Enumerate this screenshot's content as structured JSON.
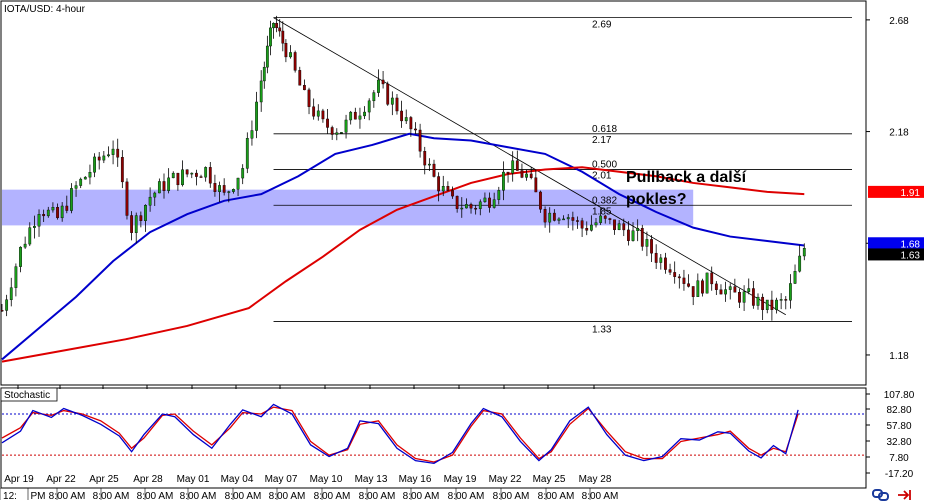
{
  "chart_data": [
    {
      "type": "candlestick",
      "title": "IOTA/USD: 4-hour",
      "ylim": [
        1.05,
        2.76
      ],
      "y_ticks": [
        2.68,
        2.18,
        1.68,
        1.18
      ],
      "x_ticks": [
        "Apr 19",
        "Apr 22",
        "Apr 25",
        "Apr 28",
        "May 01",
        "May 04",
        "May 07",
        "May 10",
        "May 13",
        "May 16",
        "May 19",
        "May 22",
        "May 25",
        "May 28"
      ],
      "x_time_ticks": [
        "12:",
        "PM",
        "8:00 AM",
        "8:00 AM",
        "8:00 AM",
        "8:00 AM",
        "8:00 AM",
        "8:00 AM",
        "8:00 AM",
        "8:00 AM",
        "8:00 AM",
        "8:00 AM",
        "8:00 AM",
        "8:00 AM",
        "8:00 AM"
      ],
      "price_path": [
        [
          0,
          1.38
        ],
        [
          3,
          1.65
        ],
        [
          6,
          1.84
        ],
        [
          9,
          1.79
        ],
        [
          12,
          1.93
        ],
        [
          15,
          2.03
        ],
        [
          18,
          2.12
        ],
        [
          21,
          1.75
        ],
        [
          24,
          1.89
        ],
        [
          27,
          1.96
        ],
        [
          30,
          1.99
        ],
        [
          33,
          2.01
        ],
        [
          36,
          1.89
        ],
        [
          39,
          2.02
        ],
        [
          42,
          2.41
        ],
        [
          44,
          2.67
        ],
        [
          46,
          2.55
        ],
        [
          49,
          2.33
        ],
        [
          52,
          2.21
        ],
        [
          55,
          2.19
        ],
        [
          58,
          2.28
        ],
        [
          61,
          2.38
        ],
        [
          64,
          2.29
        ],
        [
          67,
          2.15
        ],
        [
          70,
          1.97
        ],
        [
          73,
          1.86
        ],
        [
          76,
          1.84
        ],
        [
          79,
          1.88
        ],
        [
          82,
          2.02
        ],
        [
          85,
          1.98
        ],
        [
          88,
          1.81
        ],
        [
          91,
          1.82
        ],
        [
          94,
          1.75
        ],
        [
          97,
          1.78
        ],
        [
          100,
          1.75
        ],
        [
          103,
          1.71
        ],
        [
          106,
          1.62
        ],
        [
          109,
          1.57
        ],
        [
          112,
          1.47
        ],
        [
          115,
          1.52
        ],
        [
          118,
          1.45
        ],
        [
          121,
          1.44
        ],
        [
          124,
          1.39
        ],
        [
          127,
          1.42
        ],
        [
          130,
          1.66
        ]
      ],
      "series": [
        {
          "color": "#0000cc",
          "values": [
            [
              0,
              1.16
            ],
            [
              6,
              1.3
            ],
            [
              12,
              1.44
            ],
            [
              18,
              1.6
            ],
            [
              24,
              1.73
            ],
            [
              30,
              1.81
            ],
            [
              36,
              1.87
            ],
            [
              42,
              1.9
            ],
            [
              48,
              1.98
            ],
            [
              54,
              2.08
            ],
            [
              60,
              2.12
            ],
            [
              66,
              2.17
            ],
            [
              70,
              2.15
            ],
            [
              76,
              2.14
            ],
            [
              82,
              2.11
            ],
            [
              88,
              2.08
            ],
            [
              94,
              2.0
            ],
            [
              100,
              1.9
            ],
            [
              106,
              1.82
            ],
            [
              112,
              1.75
            ],
            [
              118,
              1.71
            ],
            [
              124,
              1.69
            ],
            [
              130,
              1.67
            ]
          ]
        },
        {
          "color": "#dd0000",
          "values": [
            [
              0,
              1.15
            ],
            [
              10,
              1.2
            ],
            [
              20,
              1.25
            ],
            [
              30,
              1.31
            ],
            [
              40,
              1.39
            ],
            [
              46,
              1.51
            ],
            [
              52,
              1.62
            ],
            [
              58,
              1.74
            ],
            [
              64,
              1.83
            ],
            [
              70,
              1.89
            ],
            [
              76,
              1.95
            ],
            [
              82,
              1.99
            ],
            [
              88,
              2.01
            ],
            [
              94,
              2.02
            ],
            [
              100,
              2.0
            ],
            [
              106,
              1.98
            ],
            [
              112,
              1.95
            ],
            [
              118,
              1.93
            ],
            [
              124,
              1.91
            ],
            [
              130,
              1.9
            ]
          ]
        }
      ],
      "fib_levels": [
        {
          "label": "2.69",
          "value": 2.69
        },
        {
          "label": "0.618",
          "value": 2.17,
          "price_label": "2.17"
        },
        {
          "label": "0.500",
          "value": 2.01,
          "price_label": "2.01"
        },
        {
          "label": "0.382",
          "value": 1.85,
          "price_label": "1.85"
        },
        {
          "label": "1.33",
          "value": 1.33
        }
      ],
      "zone": {
        "from": 1.76,
        "to": 1.92
      },
      "trendline": {
        "from": [
          44,
          2.69
        ],
        "to": [
          127,
          1.36
        ]
      },
      "annotation": "Pullback a další pokles?",
      "price_badges": [
        {
          "label": "1.91",
          "value": 1.91,
          "color": "#ff0000",
          "text_color": "#ffffff"
        },
        {
          "label": "1.68",
          "value": 1.68,
          "color": "#0000ee",
          "text_color": "#ffffff"
        },
        {
          "label": "1.63",
          "value": 1.63,
          "color": "#000000",
          "text_color": "#ffffff"
        }
      ],
      "x_range": [
        0,
        140
      ]
    },
    {
      "type": "line",
      "title": "Stochastic",
      "ylim": [
        -25,
        115
      ],
      "y_ticks": [
        "107.80",
        "82.80",
        "57.80",
        "32.80",
        "7.80",
        "-17.20"
      ],
      "levels": [
        80,
        20
      ],
      "series": [
        {
          "color": "#dd0000",
          "values": [
            [
              0,
              45
            ],
            [
              3,
              60
            ],
            [
              5,
              82
            ],
            [
              8,
              78
            ],
            [
              10,
              85
            ],
            [
              13,
              80
            ],
            [
              16,
              70
            ],
            [
              19,
              52
            ],
            [
              21,
              30
            ],
            [
              23,
              45
            ],
            [
              26,
              78
            ],
            [
              28,
              80
            ],
            [
              31,
              55
            ],
            [
              34,
              35
            ],
            [
              37,
              60
            ],
            [
              39,
              82
            ],
            [
              42,
              80
            ],
            [
              44,
              90
            ],
            [
              47,
              85
            ],
            [
              50,
              40
            ],
            [
              53,
              20
            ],
            [
              56,
              28
            ],
            [
              58,
              65
            ],
            [
              61,
              70
            ],
            [
              64,
              35
            ],
            [
              67,
              15
            ],
            [
              70,
              10
            ],
            [
              73,
              20
            ],
            [
              76,
              62
            ],
            [
              78,
              85
            ],
            [
              81,
              80
            ],
            [
              84,
              45
            ],
            [
              87,
              15
            ],
            [
              89,
              25
            ],
            [
              92,
              65
            ],
            [
              95,
              88
            ],
            [
              98,
              55
            ],
            [
              101,
              25
            ],
            [
              104,
              15
            ],
            [
              107,
              15
            ],
            [
              110,
              40
            ],
            [
              113,
              45
            ],
            [
              116,
              50
            ],
            [
              118,
              55
            ],
            [
              121,
              30
            ],
            [
              123,
              20
            ],
            [
              125,
              30
            ],
            [
              127,
              25
            ],
            [
              129,
              80
            ]
          ]
        },
        {
          "color": "#0000cc",
          "values": [
            [
              0,
              38
            ],
            [
              3,
              55
            ],
            [
              5,
              85
            ],
            [
              8,
              75
            ],
            [
              10,
              88
            ],
            [
              13,
              78
            ],
            [
              16,
              65
            ],
            [
              19,
              48
            ],
            [
              21,
              25
            ],
            [
              23,
              50
            ],
            [
              26,
              80
            ],
            [
              28,
              76
            ],
            [
              31,
              50
            ],
            [
              34,
              30
            ],
            [
              37,
              65
            ],
            [
              39,
              86
            ],
            [
              42,
              76
            ],
            [
              44,
              94
            ],
            [
              47,
              80
            ],
            [
              50,
              35
            ],
            [
              53,
              18
            ],
            [
              56,
              30
            ],
            [
              58,
              70
            ],
            [
              61,
              66
            ],
            [
              64,
              30
            ],
            [
              67,
              12
            ],
            [
              70,
              8
            ],
            [
              73,
              24
            ],
            [
              76,
              66
            ],
            [
              78,
              88
            ],
            [
              81,
              76
            ],
            [
              84,
              40
            ],
            [
              87,
              12
            ],
            [
              89,
              28
            ],
            [
              92,
              70
            ],
            [
              95,
              90
            ],
            [
              98,
              50
            ],
            [
              101,
              20
            ],
            [
              104,
              12
            ],
            [
              107,
              18
            ],
            [
              110,
              44
            ],
            [
              113,
              42
            ],
            [
              116,
              54
            ],
            [
              118,
              52
            ],
            [
              121,
              26
            ],
            [
              123,
              16
            ],
            [
              125,
              34
            ],
            [
              127,
              22
            ],
            [
              129,
              86
            ]
          ]
        }
      ],
      "x_range": [
        0,
        140
      ]
    }
  ]
}
